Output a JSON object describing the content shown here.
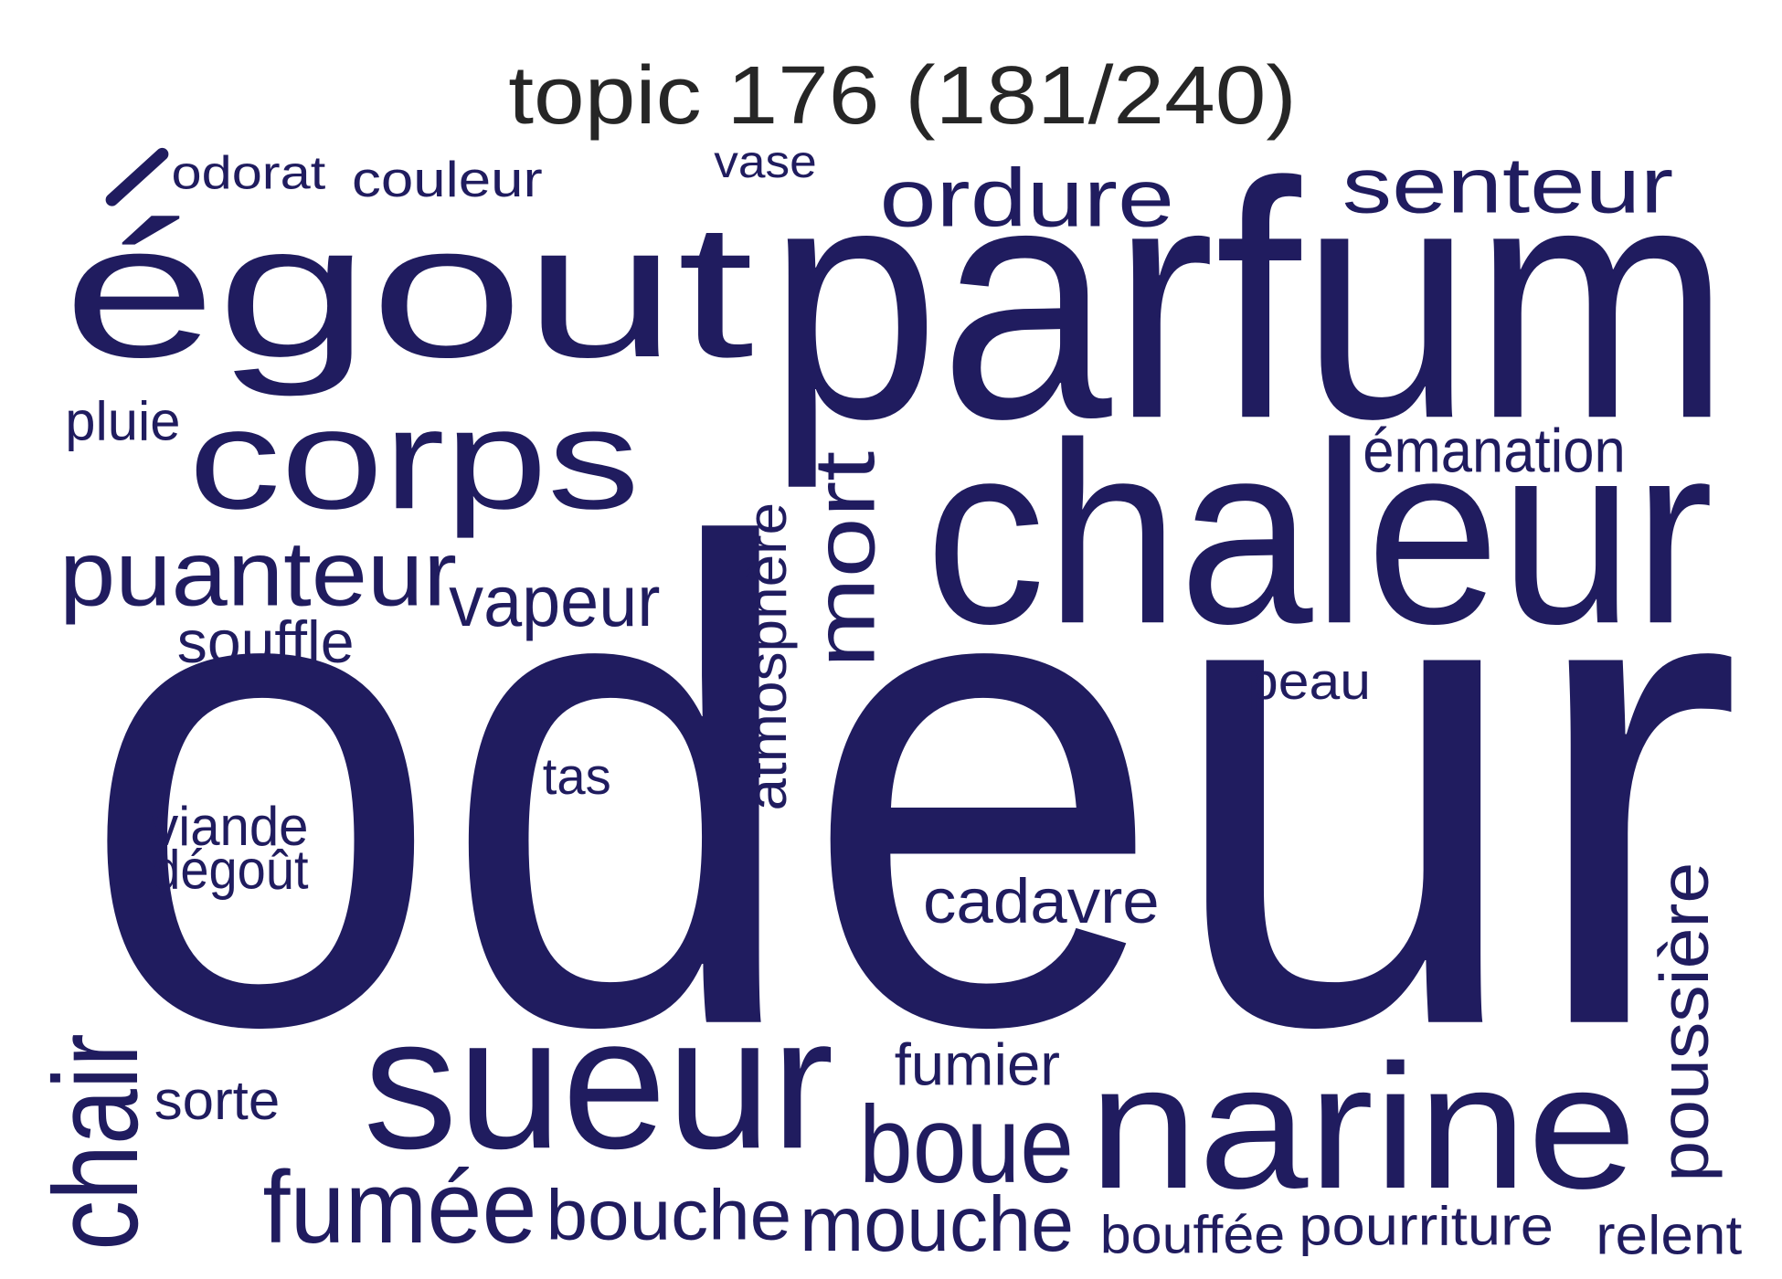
{
  "title": "topic 176 (181/240)",
  "colors": {
    "word": "#201c5f",
    "title": "#262626",
    "background": "#ffffff"
  },
  "words": [
    "odeur",
    "parfum",
    "égout",
    "chaleur",
    "narine",
    "sueur",
    "corps",
    "ordure",
    "senteur",
    "puanteur",
    "chair",
    "boue",
    "fumée",
    "mort",
    "mouche",
    "vapeur",
    "bouche",
    "cadavre",
    "poussière",
    "couleur",
    "émanation",
    "odorat",
    "souffle",
    "fumier",
    "atmosphère",
    "pourriture",
    "vase",
    "pluie",
    "viande",
    "dégoût",
    "sorte",
    "tas",
    "peau",
    "bouffée",
    "relent"
  ]
}
